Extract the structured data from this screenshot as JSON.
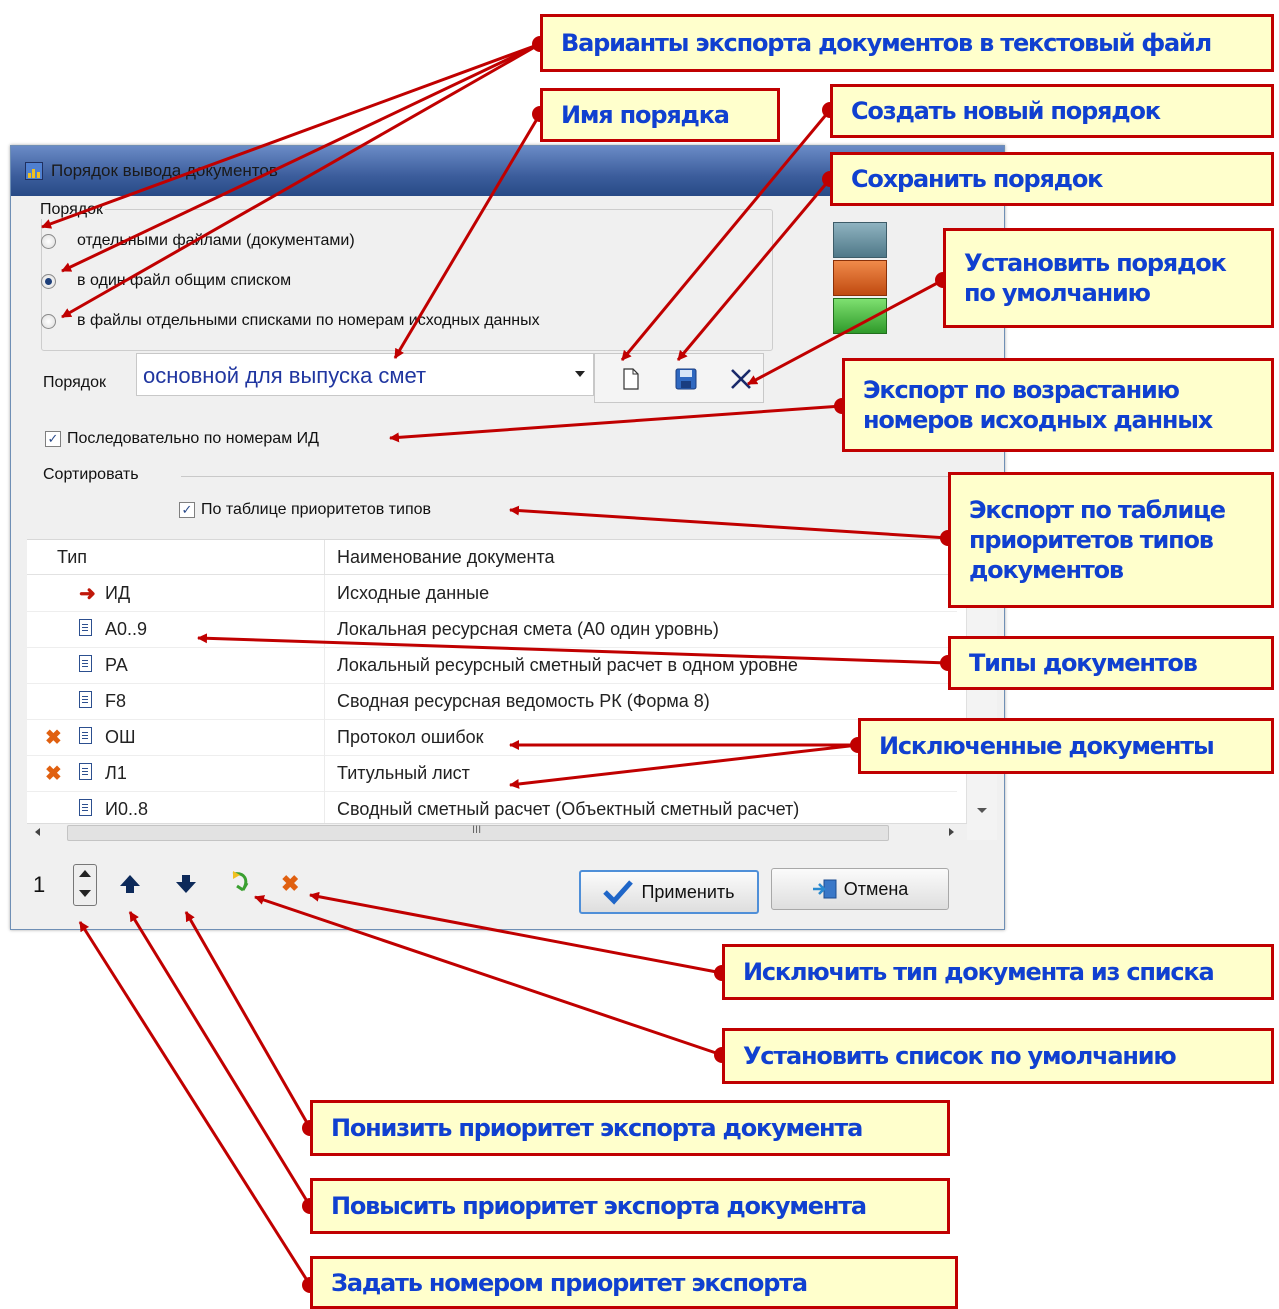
{
  "window": {
    "title": "Порядок вывода документов"
  },
  "order_group": {
    "legend": "Порядок",
    "options": [
      {
        "label": "отдельными файлами (документами)",
        "selected": false
      },
      {
        "label": "в один файл общим списком",
        "selected": true
      },
      {
        "label": "в файлы отдельными списками по номерам исходных данных",
        "selected": false
      }
    ]
  },
  "order_select": {
    "label": "Порядок",
    "value": "основной для выпуска смет"
  },
  "sequential_checkbox": {
    "label": "Последовательно по номерам ИД",
    "checked": true
  },
  "sort": {
    "label": "Сортировать",
    "priority_checkbox": {
      "label": "По таблице приоритетов типов",
      "checked": true
    }
  },
  "table": {
    "columns": [
      "Тип",
      "Наименование документа"
    ],
    "rows": [
      {
        "type": "ИД",
        "name": "Исходные данные",
        "excluded": false,
        "icon": "arrow-right-icon"
      },
      {
        "type": "А0..9",
        "name": "Локальная ресурсная смета (А0 один уровнь)",
        "excluded": false,
        "icon": "document-icon"
      },
      {
        "type": "РА",
        "name": "Локальный ресурсный сметный расчет в одном уровне",
        "excluded": false,
        "icon": "document-icon"
      },
      {
        "type": "F8",
        "name": "Сводная ресурсная ведомость РК (Форма 8)",
        "excluded": false,
        "icon": "document-icon"
      },
      {
        "type": "ОШ",
        "name": "Протокол ошибок",
        "excluded": true,
        "icon": "document-icon"
      },
      {
        "type": "Л1",
        "name": "Титульный лист",
        "excluded": true,
        "icon": "document-icon"
      },
      {
        "type": "И0..8",
        "name": "Сводный сметный расчет (Объектный сметный расчет)",
        "excluded": false,
        "icon": "document-icon"
      }
    ],
    "hscroll_mark": "III"
  },
  "priority_spin": {
    "value": "1"
  },
  "buttons": {
    "apply": "Применить",
    "cancel": "Отмена"
  },
  "callouts": {
    "export_variants": "Варианты экспорта документов в текстовый файл",
    "order_name": "Имя порядка",
    "create_order": "Создать новый порядок",
    "save_order": "Сохранить порядок",
    "default_order_1": "Установить порядок",
    "default_order_2": "по умолчанию",
    "export_asc_1": "Экспорт по возрастанию",
    "export_asc_2": "номеров исходных данных",
    "export_priority_1": "Экспорт по таблице",
    "export_priority_2": "приоритетов типов",
    "export_priority_3": "документов",
    "doc_types": "Типы документов",
    "excluded_docs": "Исключенные документы",
    "exclude_type": "Исключить тип документа из списка",
    "default_list": "Установить список по умолчанию",
    "lower_priority": "Понизить приоритет экспорта документа",
    "raise_priority": "Повысить приоритет экспорта документа",
    "set_priority": "Задать номером приоритет экспорта"
  },
  "colors": {
    "callout_bg": "#ffffcc",
    "callout_border": "#c00000",
    "callout_text": "#1040d0",
    "arrow": "#c00000"
  }
}
